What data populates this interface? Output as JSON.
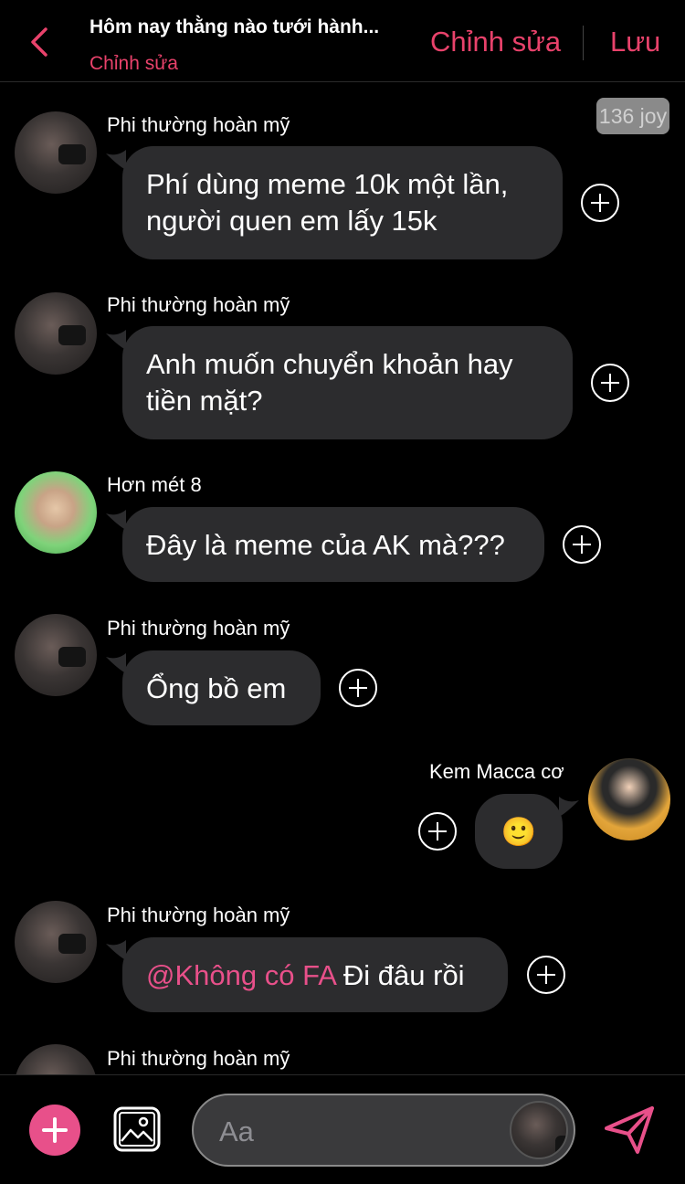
{
  "header": {
    "title": "Hôm nay thằng nào tưới hành...",
    "subtitle": "Chỉnh sửa",
    "edit_label": "Chỉnh sửa",
    "save_label": "Lưu",
    "accent_color": "#e8426b"
  },
  "badge": {
    "text": "136 joy"
  },
  "messages": [
    {
      "sender": "Phi thường hoàn mỹ",
      "text": [
        "Phí dùng meme 10k một lần,",
        "người quen em lấy 15k"
      ],
      "side": "left",
      "avatar": "dark-masked"
    },
    {
      "sender": "Phi thường hoàn mỹ",
      "text": [
        "Anh muốn chuyển khoản hay",
        "tiền mặt?"
      ],
      "side": "left",
      "avatar": "dark-masked"
    },
    {
      "sender": "Hơn mét 8",
      "text": [
        "Đây là meme của AK mà???"
      ],
      "side": "left",
      "avatar": "green"
    },
    {
      "sender": "Phi thường hoàn mỹ",
      "text": [
        "Ổng bồ em"
      ],
      "side": "left",
      "avatar": "dark-masked"
    },
    {
      "sender": "Kem Macca cơ",
      "text": [
        "🙂"
      ],
      "side": "right",
      "avatar": "yellow"
    },
    {
      "sender": "Phi thường hoàn mỹ",
      "mention": "@Không có FA",
      "text": [
        " Đi đâu rồi"
      ],
      "side": "left",
      "avatar": "dark-masked"
    },
    {
      "sender": "Phi thường hoàn mỹ",
      "text": [],
      "side": "left",
      "avatar": "dark-masked"
    }
  ],
  "composer": {
    "placeholder": "Aa",
    "icons": [
      "add-icon",
      "image-icon",
      "send-icon"
    ],
    "accent_color": "#e8508a"
  }
}
